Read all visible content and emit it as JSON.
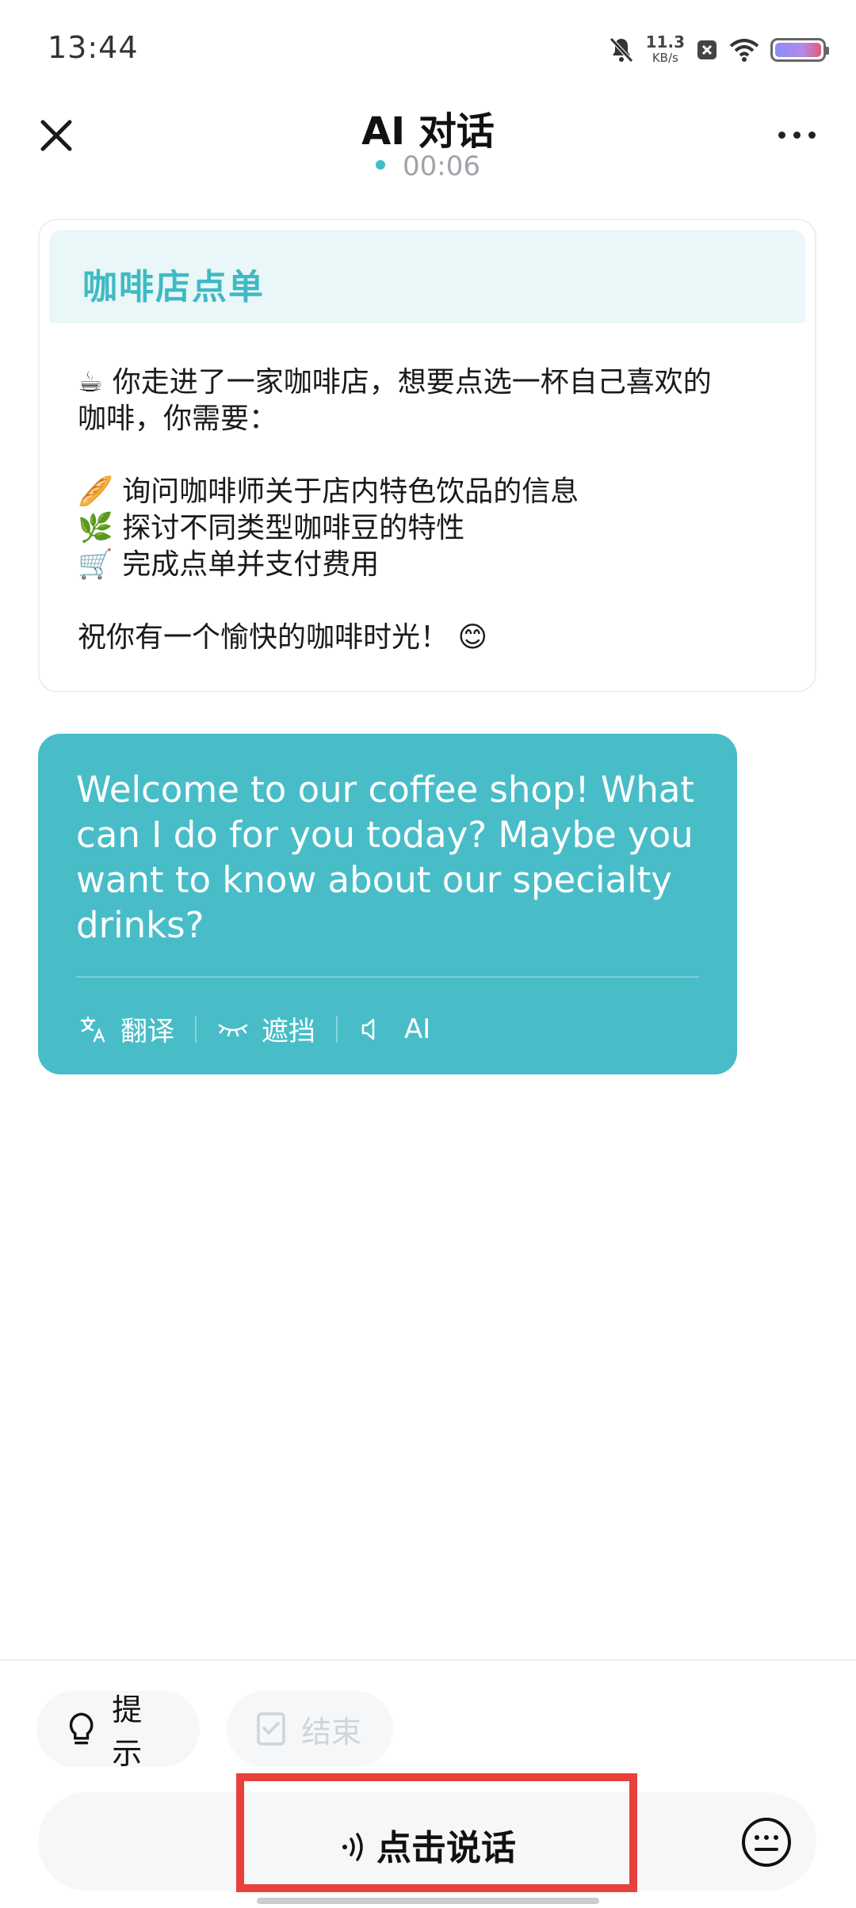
{
  "status_bar": {
    "time": "13:44",
    "net_speed_value": "11.3",
    "net_speed_unit": "KB/s",
    "icons": [
      "bell-muted-icon",
      "x-square-icon",
      "wifi-icon",
      "battery-icon"
    ]
  },
  "header": {
    "title": "AI 对话",
    "timer": "00:06"
  },
  "scenario": {
    "title": "咖啡店点单",
    "intro_emoji": "☕",
    "intro_line1": "你走进了一家咖啡店，想要点选一杯自己喜欢的",
    "intro_line2": "咖啡，你需要：",
    "tasks": [
      {
        "emoji": "🥖",
        "text": "询问咖啡师关于店内特色饮品的信息"
      },
      {
        "emoji": "🌿",
        "text": "探讨不同类型咖啡豆的特性"
      },
      {
        "emoji": "🛒",
        "text": "完成点单并支付费用"
      }
    ],
    "closing": "祝你有一个愉快的咖啡时光！",
    "closing_emoji": "😊"
  },
  "ai_message": {
    "text": "Welcome to our coffee shop! What can I do for you today? Maybe you want to know about our specialty drinks?",
    "actions": {
      "translate": "翻译",
      "hide": "遮挡",
      "voice": "AI"
    }
  },
  "bottom": {
    "hint_label": "提示",
    "end_label": "结束",
    "talk_label": "点击说话"
  },
  "colors": {
    "accent": "#48bdc8",
    "highlight_box": "#e8413b"
  }
}
